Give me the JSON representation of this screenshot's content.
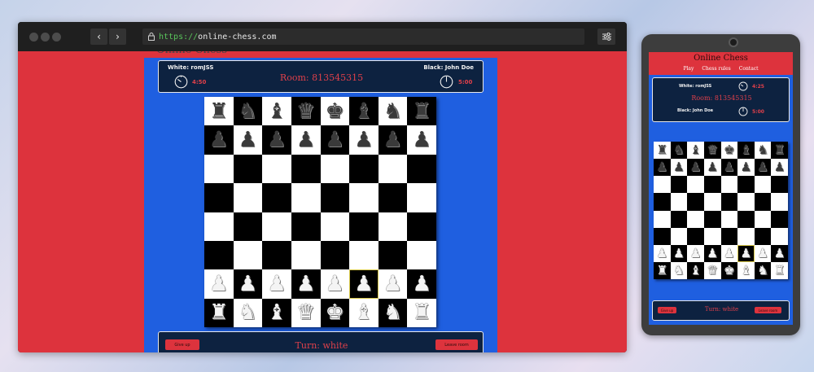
{
  "browser": {
    "url_scheme": "https://",
    "url_host": "online-chess.com",
    "back_icon": "chevron-left-icon",
    "forward_icon": "chevron-right-icon",
    "settings_icon": "sliders-icon"
  },
  "site": {
    "title": "Online Chess",
    "nav": [
      "Play",
      "Chess rules",
      "Contact"
    ]
  },
  "game": {
    "white_label": "White: romJSS",
    "black_label": "Black: John Doe",
    "white_time_desktop": "4:50",
    "black_time_desktop": "5:00",
    "white_time_mobile": "4:25",
    "black_time_mobile": "5:00",
    "room": "Room: 813545315",
    "turn": "Turn: white",
    "give_up": "Give up",
    "leave_room": "Leave room"
  },
  "board": {
    "rows": [
      [
        "r",
        "n",
        "b",
        "q",
        "k",
        "b",
        "n",
        "r"
      ],
      [
        "p",
        "p",
        "p",
        "p",
        "p",
        "p",
        "p",
        "p"
      ],
      [
        "",
        "",
        "",
        "",
        "",
        "",
        "",
        ""
      ],
      [
        "",
        "",
        "",
        "",
        "",
        "",
        "",
        ""
      ],
      [
        "",
        "",
        "",
        "",
        "",
        "",
        "",
        ""
      ],
      [
        "",
        "",
        "",
        "",
        "",
        "",
        "",
        ""
      ],
      [
        "P",
        "P",
        "P",
        "P",
        "P",
        "P",
        "P",
        "P"
      ],
      [
        "R",
        "N",
        "B",
        "Q",
        "K",
        "B",
        "N",
        "R"
      ]
    ],
    "highlight": [
      6,
      5
    ]
  },
  "colors": {
    "page_red": "#dd333d",
    "game_blue": "#1f5fe0",
    "panel_navy": "#0d2240",
    "accent_red": "#e0404a"
  }
}
